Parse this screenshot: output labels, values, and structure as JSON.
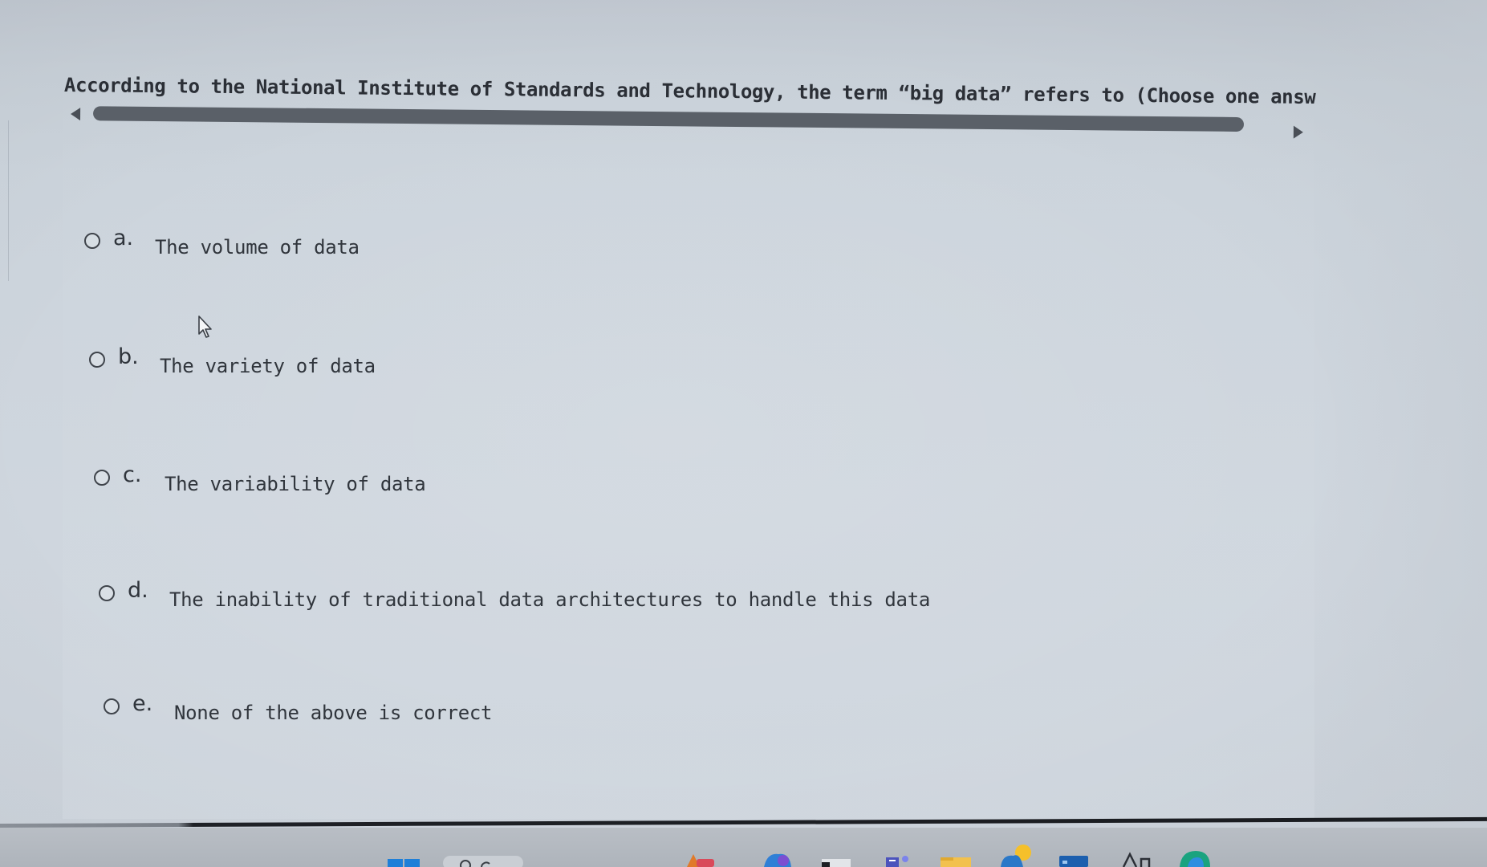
{
  "question": {
    "text": "According to the National Institute of Standards and Technology, the term “big data” refers to (Choose one answ"
  },
  "options": [
    {
      "letter": "a.",
      "text": "The volume of data"
    },
    {
      "letter": "b.",
      "text": "The variety of data"
    },
    {
      "letter": "c.",
      "text": "The variability of data"
    },
    {
      "letter": "d.",
      "text": "The inability of traditional data architectures to handle this data"
    },
    {
      "letter": "e.",
      "text": "None of the above is correct"
    }
  ],
  "colors": {
    "background": "#cfd6de",
    "text": "#30353c",
    "scrollbar": "#5a6068"
  },
  "taskbar": {
    "icons": [
      "windows-start-icon",
      "search-icon",
      "app-icon",
      "copilot-icon",
      "task-view-icon",
      "teams-icon",
      "file-explorer-icon",
      "weather-icon",
      "store-icon",
      "font-icon",
      "edge-icon"
    ]
  }
}
